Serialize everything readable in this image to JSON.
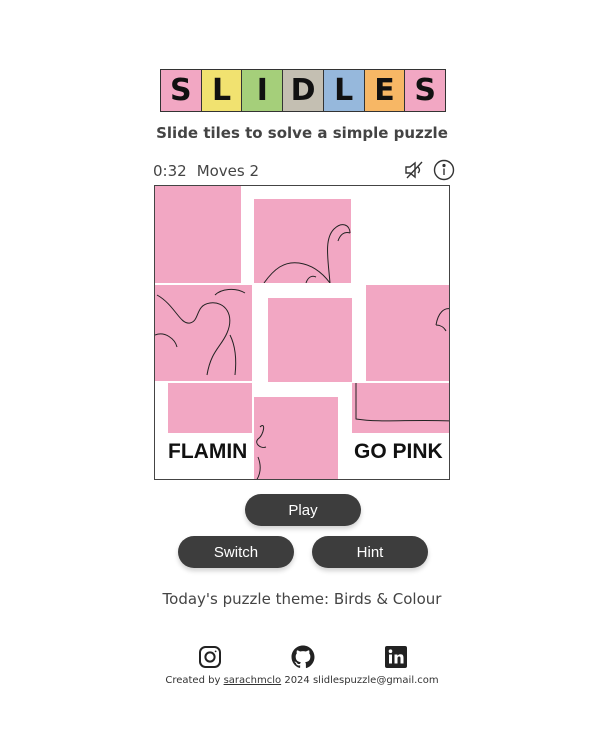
{
  "logo": {
    "letters": [
      {
        "char": "S",
        "color": "#f2a7c3"
      },
      {
        "char": "L",
        "color": "#f1e270"
      },
      {
        "char": "I",
        "color": "#a5cf7a"
      },
      {
        "char": "D",
        "color": "#c4bfb2"
      },
      {
        "char": "L",
        "color": "#96b8dc"
      },
      {
        "char": "E",
        "color": "#f7b765"
      },
      {
        "char": "S",
        "color": "#f2a7c3"
      }
    ]
  },
  "tagline": "Slide tiles to solve a simple puzzle",
  "stats": {
    "timer": "0:32",
    "moves_label": "Moves",
    "moves_value": "2"
  },
  "icons": {
    "sound": "muted-speaker-icon",
    "info": "info-icon"
  },
  "board": {
    "tile_color": "#f2a7c3",
    "text_left": "FLAMIN",
    "text_right": "GO PINK"
  },
  "buttons": {
    "play": "Play",
    "switch": "Switch",
    "hint": "Hint"
  },
  "theme_text": "Today's puzzle theme: Birds & Colour",
  "social": [
    "instagram-icon",
    "github-icon",
    "linkedin-icon"
  ],
  "footer": {
    "created_by": "Created by",
    "author": "sarachmclo",
    "rest": "2024 slidlespuzzle@gmail.com"
  }
}
